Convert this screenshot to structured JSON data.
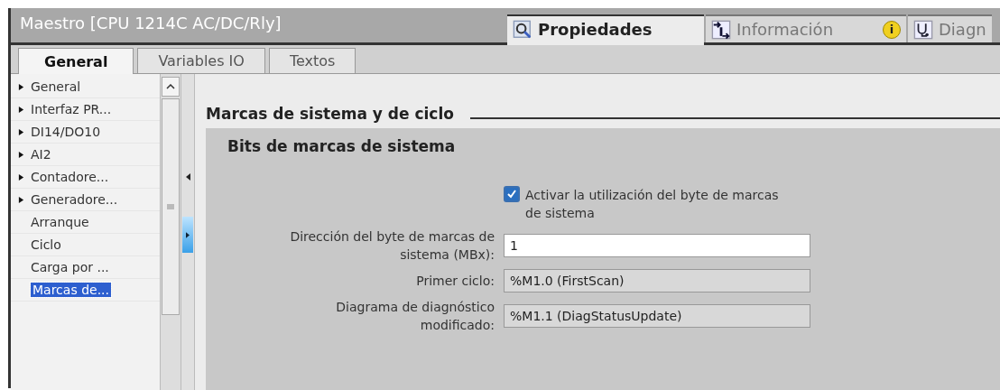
{
  "window": {
    "title": "Maestro [CPU 1214C AC/DC/Rly]"
  },
  "inspector_tabs": [
    {
      "label": "Propiedades",
      "kind": "properties",
      "selected": true
    },
    {
      "label": "Información",
      "kind": "info",
      "selected": false,
      "badge": "i"
    },
    {
      "label": "Diagn",
      "kind": "diagnostics",
      "selected": false
    }
  ],
  "tabs": [
    {
      "label": "General",
      "selected": true
    },
    {
      "label": "Variables IO",
      "selected": false
    },
    {
      "label": "Textos",
      "selected": false
    }
  ],
  "sidebar": {
    "items": [
      {
        "label": "General",
        "expandable": true,
        "selected": false
      },
      {
        "label": "Interfaz PR...",
        "expandable": true,
        "selected": false
      },
      {
        "label": "DI14/DO10",
        "expandable": true,
        "selected": false
      },
      {
        "label": "AI2",
        "expandable": true,
        "selected": false
      },
      {
        "label": "Contadore...",
        "expandable": true,
        "selected": false
      },
      {
        "label": "Generadore...",
        "expandable": true,
        "selected": false
      },
      {
        "label": "Arranque",
        "expandable": false,
        "selected": false
      },
      {
        "label": "Ciclo",
        "expandable": false,
        "selected": false
      },
      {
        "label": "Carga por ...",
        "expandable": false,
        "selected": false
      },
      {
        "label": "Marcas de...",
        "expandable": false,
        "selected": true
      }
    ]
  },
  "section": {
    "title": "Marcas de sistema y de ciclo",
    "group": {
      "title": "Bits de marcas de sistema",
      "checkbox": {
        "label": "Activar la utilización del byte de marcas de sistema",
        "checked": true
      },
      "fields": [
        {
          "label": "Dirección del byte de marcas de sistema (MBx):",
          "value": "1",
          "editable": true
        },
        {
          "label": "Primer ciclo:",
          "value": "%M1.0 (FirstScan)",
          "editable": false
        },
        {
          "label": "Diagrama de diagnóstico modificado:",
          "value": "%M1.1 (DiagStatusUpdate)",
          "editable": false
        }
      ]
    }
  }
}
